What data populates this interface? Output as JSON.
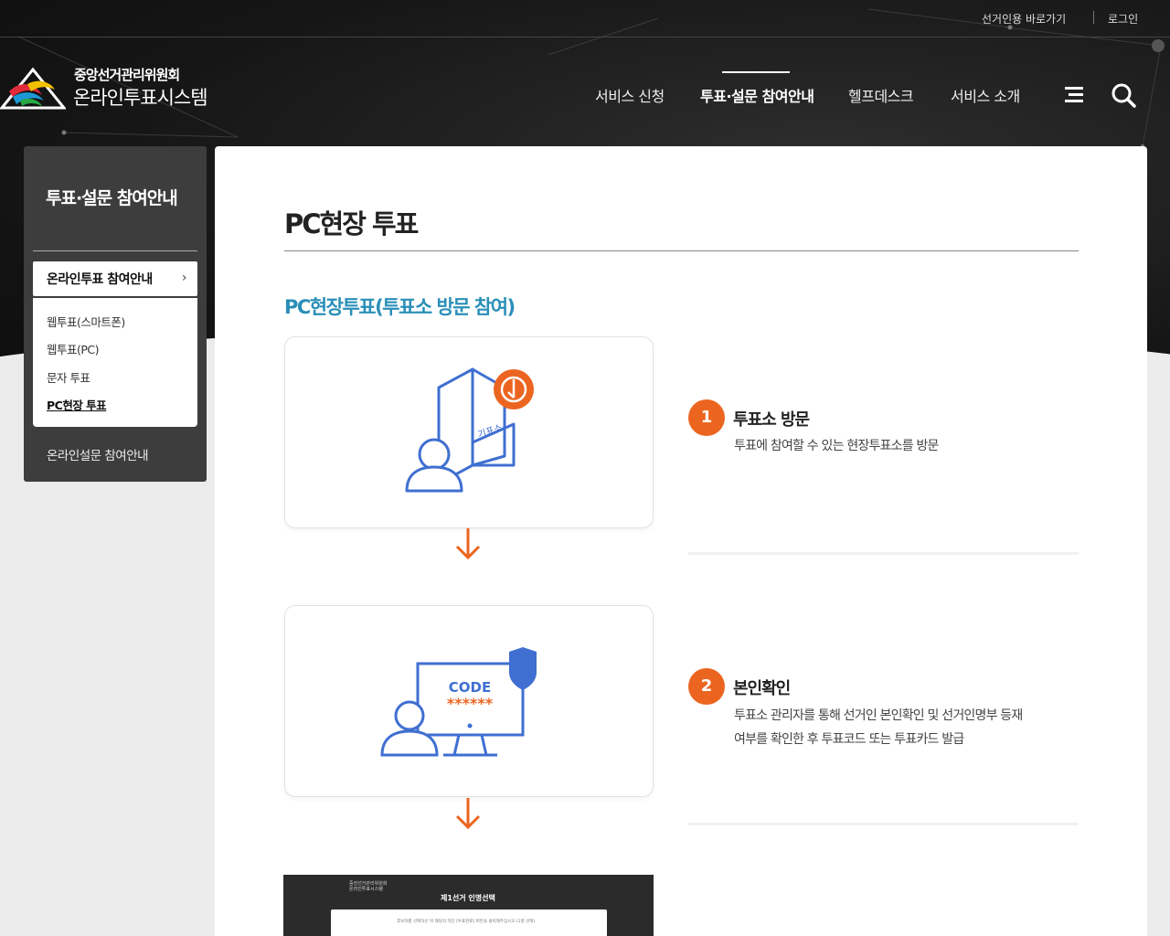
{
  "util": {
    "election_link": "선거인용 바로가기",
    "login": "로그인"
  },
  "logo": {
    "sub": "중앙선거관리위원회",
    "main": "온라인투표시스템"
  },
  "gnb": [
    {
      "label": "서비스 신청"
    },
    {
      "label": "투표·설문 참여안내"
    },
    {
      "label": "헬프데스크"
    },
    {
      "label": "서비스 소개"
    }
  ],
  "icons": {
    "menu": "hamburger-icon",
    "search": "search-icon"
  },
  "lnb": {
    "title": "투표·설문 참여안내",
    "current": "온라인투표 참여안내",
    "sub": [
      "웹투표(스마트폰)",
      "웹투표(PC)",
      "문자 투표",
      "PC현장 투표"
    ],
    "other": "온라인설문 참여안내"
  },
  "page": {
    "title": "PC현장 투표",
    "section": "PC현장투표(투표소 방문 참여)",
    "steps": [
      {
        "num": "1",
        "title": "투표소 방문",
        "desc": [
          "투표에 참여할 수 있는 현장투표소를 방문"
        ],
        "card_label": "기표소"
      },
      {
        "num": "2",
        "title": "본인확인",
        "desc": [
          "투표소 관리자를 통해 선거인 본인확인 및 선거인명부 등재",
          "여부를 확인한 후 투표코드 또는 투표카드 발급"
        ],
        "card_label": "CODE",
        "card_code": "******"
      }
    ],
    "preview": {
      "logo_a": "중앙선거관리위원회",
      "logo_b": "온라인투표시스템",
      "heading": "제1선거 인명선택",
      "text": "후보자를 선택하신 뒤 해당의 하단 [투표완료] 버튼을 클릭해주십시오 (1명 선택)"
    }
  },
  "colors": {
    "accent_orange": "#ec6520",
    "section_blue": "#2a8fb8",
    "icon_blue": "#3f6fd1",
    "dark_bg": "#161616"
  }
}
